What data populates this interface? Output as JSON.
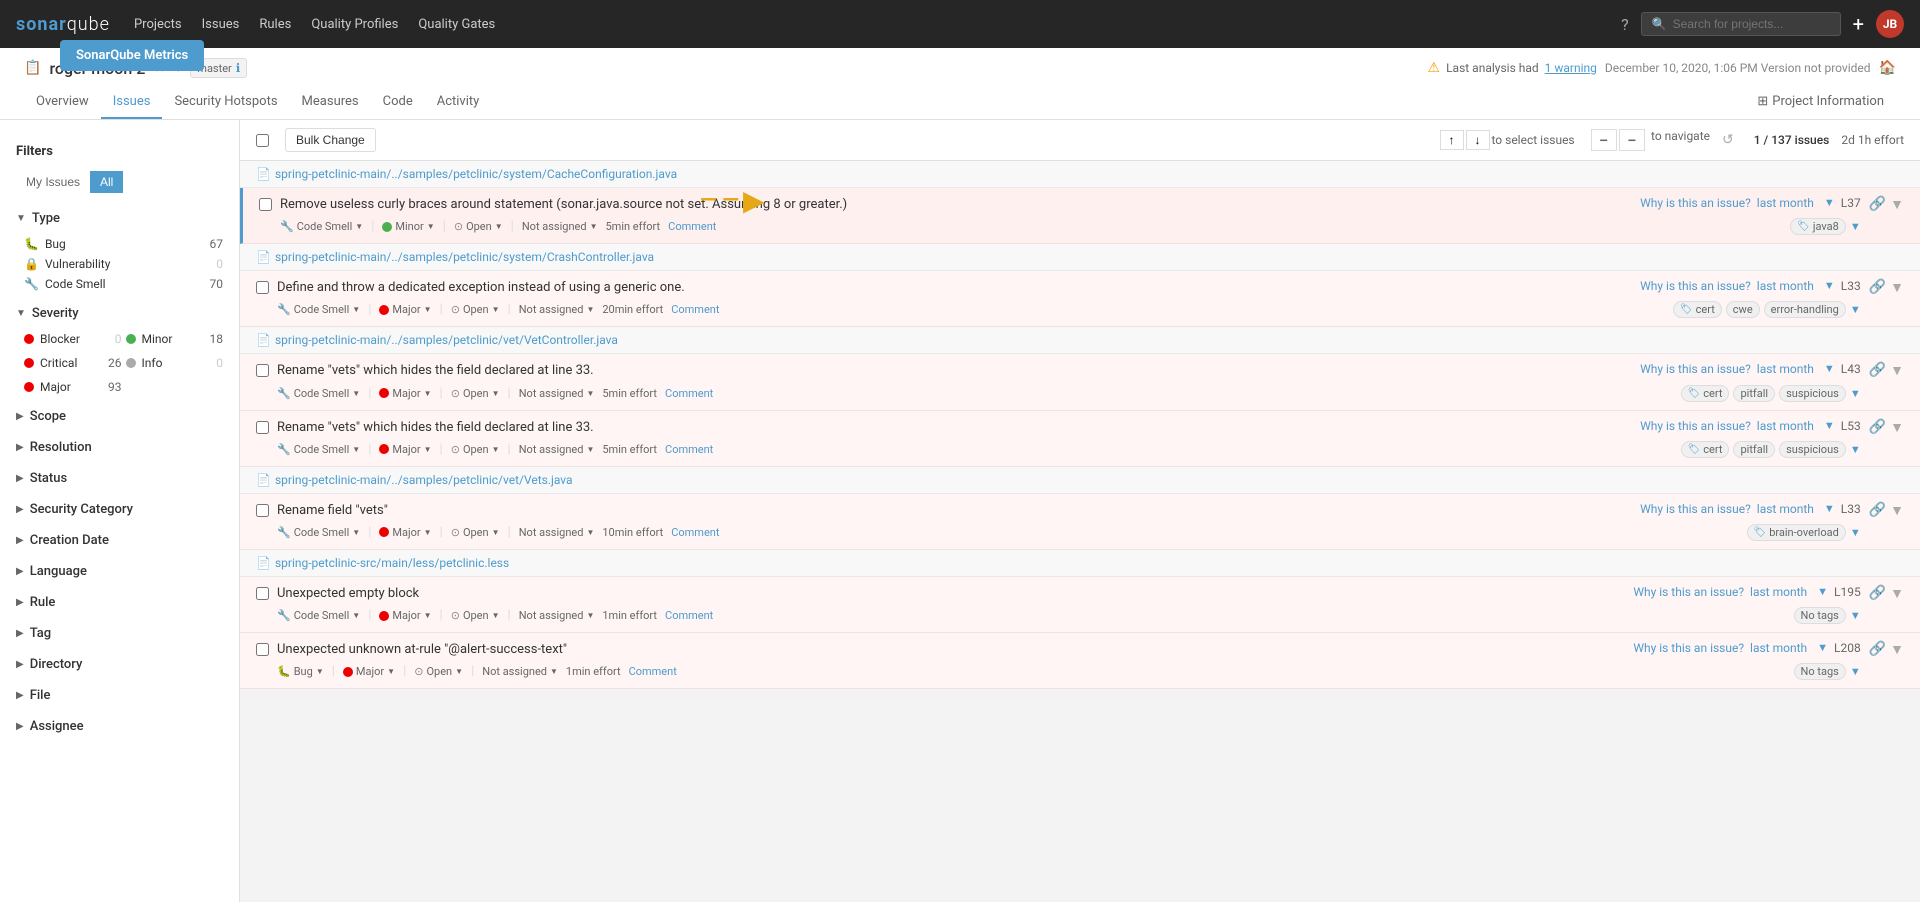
{
  "badge": {
    "label": "SonarQube Metrics"
  },
  "topnav": {
    "logo": "sonarqube",
    "links": [
      "Projects",
      "Issues",
      "Rules",
      "Quality Profiles",
      "Quality Gates"
    ],
    "search_placeholder": "Search for projects...",
    "add_label": "+",
    "avatar": "JB"
  },
  "project": {
    "name": "roger moon 2",
    "branch": "master",
    "warning_prefix": "Last analysis had",
    "warning_link": "1 warning",
    "analysis_time": "December 10, 2020, 1:06 PM  Version not provided",
    "subnav": [
      "Overview",
      "Issues",
      "Security Hotspots",
      "Measures",
      "Code",
      "Activity"
    ],
    "active_tab": "Issues",
    "project_info_label": "Project Information"
  },
  "filters": {
    "label": "Filters",
    "my_issues": "My Issues",
    "all": "All",
    "sections": [
      {
        "label": "Type",
        "items": [
          {
            "label": "Bug",
            "count": "67",
            "icon": "bug"
          },
          {
            "label": "Vulnerability",
            "count": "0",
            "icon": "vulnerability"
          },
          {
            "label": "Code Smell",
            "count": "70",
            "icon": "smell"
          }
        ]
      },
      {
        "label": "Severity",
        "items": [
          {
            "label": "Blocker",
            "count": "0",
            "severity": "blocker"
          },
          {
            "label": "Minor",
            "count": "18",
            "severity": "minor"
          },
          {
            "label": "Critical",
            "count": "26",
            "severity": "critical"
          },
          {
            "label": "Info",
            "count": "0",
            "severity": "info"
          },
          {
            "label": "Major",
            "count": "93",
            "severity": "major"
          }
        ]
      },
      {
        "label": "Scope"
      },
      {
        "label": "Resolution"
      },
      {
        "label": "Status"
      },
      {
        "label": "Security Category"
      },
      {
        "label": "Creation Date"
      },
      {
        "label": "Language"
      },
      {
        "label": "Rule"
      },
      {
        "label": "Tag"
      },
      {
        "label": "Directory"
      },
      {
        "label": "File"
      },
      {
        "label": "Assignee"
      }
    ]
  },
  "toolbar": {
    "my_issues": "My Issues",
    "all": "All",
    "bulk_change": "Bulk Change",
    "to_select": "to select issues",
    "to_navigate": "to navigate",
    "issue_count": "1 / 137 issues",
    "effort": "2d 1h effort"
  },
  "issues": [
    {
      "file": "spring-petclinic-main/../samples/petclinic/system/CacheConfiguration.java",
      "items": [
        {
          "title": "Remove useless curly braces around statement (sonar.java.source not set. Assuming 8 or greater.)",
          "why": "Why is this an issue?",
          "time": "last month",
          "line": "L37",
          "type": "Code Smell",
          "severity": "Minor",
          "status": "Open",
          "assignee": "Not assigned",
          "effort": "5min effort",
          "tags": [
            "java8"
          ],
          "highlighted": true
        }
      ]
    },
    {
      "file": "spring-petclinic-main/../samples/petclinic/system/CrashController.java",
      "items": [
        {
          "title": "Define and throw a dedicated exception instead of using a generic one.",
          "why": "Why is this an issue?",
          "time": "last month",
          "line": "L33",
          "type": "Code Smell",
          "severity": "Major",
          "status": "Open",
          "assignee": "Not assigned",
          "effort": "20min effort",
          "tags": [
            "cert",
            "cwe",
            "error-handling"
          ],
          "highlighted": false
        }
      ]
    },
    {
      "file": "spring-petclinic-main/../samples/petclinic/vet/VetController.java",
      "items": [
        {
          "title": "Rename \"vets\" which hides the field declared at line 33.",
          "why": "Why is this an issue?",
          "time": "last month",
          "line": "L43",
          "type": "Code Smell",
          "severity": "Major",
          "status": "Open",
          "assignee": "Not assigned",
          "effort": "5min effort",
          "tags": [
            "cert",
            "pitfall",
            "suspicious"
          ],
          "highlighted": false
        },
        {
          "title": "Rename \"vets\" which hides the field declared at line 33.",
          "why": "Why is this an issue?",
          "time": "last month",
          "line": "L53",
          "type": "Code Smell",
          "severity": "Major",
          "status": "Open",
          "assignee": "Not assigned",
          "effort": "5min effort",
          "tags": [
            "cert",
            "pitfall",
            "suspicious"
          ],
          "highlighted": false
        }
      ]
    },
    {
      "file": "spring-petclinic-main/../samples/petclinic/vet/Vets.java",
      "items": [
        {
          "title": "Rename field \"vets\"",
          "why": "Why is this an issue?",
          "time": "last month",
          "line": "L33",
          "type": "Code Smell",
          "severity": "Major",
          "status": "Open",
          "assignee": "Not assigned",
          "effort": "10min effort",
          "tags": [
            "brain-overload"
          ],
          "highlighted": false
        }
      ]
    },
    {
      "file": "spring-petclinic-src/main/less/petclinic.less",
      "items": [
        {
          "title": "Unexpected empty block",
          "why": "Why is this an issue?",
          "time": "last month",
          "line": "L195",
          "type": "Code Smell",
          "severity": "Major",
          "status": "Open",
          "assignee": "Not assigned",
          "effort": "1min effort",
          "tags": [
            "No tags"
          ],
          "highlighted": false
        },
        {
          "title": "Unexpected unknown at-rule \"@alert-success-text\"",
          "why": "Why is this an issue?",
          "time": "last month",
          "line": "L208",
          "type": "Bug",
          "severity": "Major",
          "status": "Open",
          "assignee": "Not assigned",
          "effort": "1min effort",
          "tags": [
            "No tags"
          ],
          "highlighted": false
        }
      ]
    }
  ]
}
